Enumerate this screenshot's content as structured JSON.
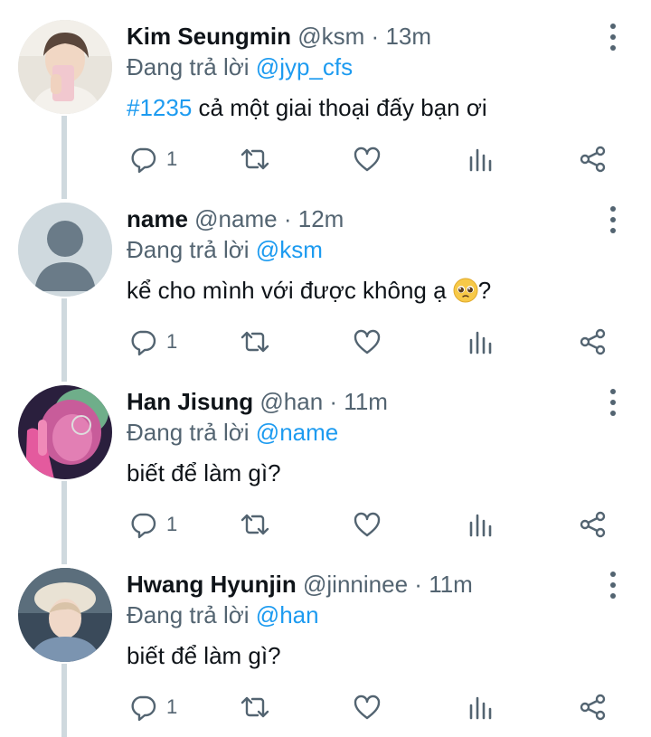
{
  "tweets": [
    {
      "author": "Kim Seungmin",
      "handle": "@ksm",
      "time": "13m",
      "reply_prefix": "Đang trả lời",
      "reply_to": "@jyp_cfs",
      "hashtag": "#1235",
      "text": " cả một giai thoại đấy bạn ơi",
      "reply_count": "1",
      "avatar": "photo-selfie"
    },
    {
      "author": "name",
      "handle": "@name",
      "time": "12m",
      "reply_prefix": "Đang trả lời",
      "reply_to": "@ksm",
      "text": "kể cho mình với được không ạ ",
      "text_suffix": "?",
      "emoji": "pleading-face-emoji",
      "reply_count": "1",
      "avatar": "default-avatar"
    },
    {
      "author": "Han Jisung",
      "handle": "@han",
      "time": "11m",
      "reply_prefix": "Đang trả lời",
      "reply_to": "@name",
      "text": "biết để làm gì?",
      "reply_count": "1",
      "avatar": "photo-pink"
    },
    {
      "author": "Hwang Hyunjin",
      "handle": "@jinninee",
      "time": "11m",
      "reply_prefix": "Đang trả lời",
      "reply_to": "@han",
      "text": "biết để làm gì?",
      "reply_count": "1",
      "avatar": "photo-beret"
    }
  ],
  "icons": {
    "reply": "reply-icon",
    "retweet": "retweet-icon",
    "like": "heart-icon",
    "analytics": "analytics-icon",
    "share": "share-icon",
    "more": "more-vertical-icon"
  },
  "colors": {
    "link": "#1d9bf0",
    "secondary": "#536471",
    "text": "#0f1419",
    "thread_line": "#cfd9de"
  }
}
